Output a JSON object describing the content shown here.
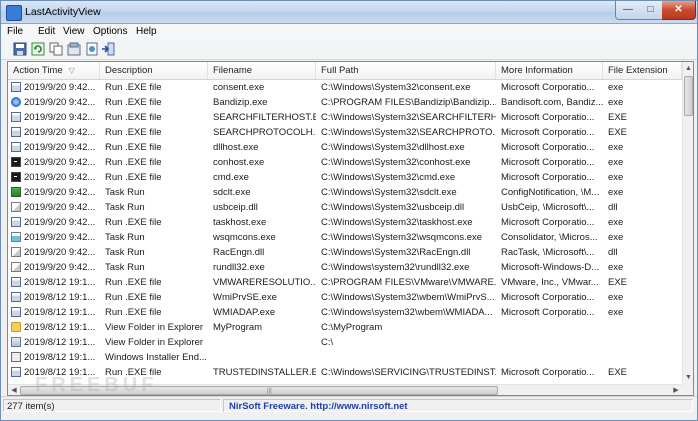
{
  "window": {
    "title": "LastActivityView"
  },
  "menu": [
    "File",
    "Edit",
    "View",
    "Options",
    "Help"
  ],
  "toolbar_icons": [
    "save-icon",
    "refresh-icon",
    "copy-icon",
    "properties-icon",
    "html-report-icon",
    "exit-icon"
  ],
  "columns": [
    {
      "label": "Action Time",
      "sort": "▽"
    },
    {
      "label": "Description"
    },
    {
      "label": "Filename"
    },
    {
      "label": "Full Path"
    },
    {
      "label": "More Information"
    },
    {
      "label": "File Extension"
    }
  ],
  "rows": [
    {
      "icon": "exe-icon",
      "time": "2019/9/20 9:42...",
      "description": "Run .EXE file",
      "filename": "consent.exe",
      "path": "C:\\Windows\\System32\\consent.exe",
      "info": "Microsoft Corporatio...",
      "ext": "exe"
    },
    {
      "icon": "bandizip-icon",
      "time": "2019/9/20 9:42...",
      "description": "Run .EXE file",
      "filename": "Bandizip.exe",
      "path": "C:\\PROGRAM FILES\\Bandizip\\Bandizip....",
      "info": "Bandisoft.com, Bandiz...",
      "ext": "exe"
    },
    {
      "icon": "exe-icon",
      "time": "2019/9/20 9:42...",
      "description": "Run .EXE file",
      "filename": "SEARCHFILTERHOST.E...",
      "path": "C:\\Windows\\System32\\SEARCHFILTERH...",
      "info": "Microsoft Corporatio...",
      "ext": "EXE"
    },
    {
      "icon": "exe-icon",
      "time": "2019/9/20 9:42...",
      "description": "Run .EXE file",
      "filename": "SEARCHPROTOCOLH...",
      "path": "C:\\Windows\\System32\\SEARCHPROTO...",
      "info": "Microsoft Corporatio...",
      "ext": "EXE"
    },
    {
      "icon": "exe-icon",
      "time": "2019/9/20 9:42...",
      "description": "Run .EXE file",
      "filename": "dllhost.exe",
      "path": "C:\\Windows\\System32\\dllhost.exe",
      "info": "Microsoft Corporatio...",
      "ext": "exe"
    },
    {
      "icon": "console-icon",
      "time": "2019/9/20 9:42...",
      "description": "Run .EXE file",
      "filename": "conhost.exe",
      "path": "C:\\Windows\\System32\\conhost.exe",
      "info": "Microsoft Corporatio...",
      "ext": "exe"
    },
    {
      "icon": "cmd-icon",
      "time": "2019/9/20 9:42...",
      "description": "Run .EXE file",
      "filename": "cmd.exe",
      "path": "C:\\Windows\\System32\\cmd.exe",
      "info": "Microsoft Corporatio...",
      "ext": "exe"
    },
    {
      "icon": "monitor-icon",
      "time": "2019/9/20 9:42...",
      "description": "Task Run",
      "filename": "sdclt.exe",
      "path": "C:\\Windows\\System32\\sdclt.exe",
      "info": "ConfigNotification, \\M...",
      "ext": "exe"
    },
    {
      "icon": "dll-icon",
      "time": "2019/9/20 9:42...",
      "description": "Task Run",
      "filename": "usbceip.dll",
      "path": "C:\\Windows\\System32\\usbceip.dll",
      "info": "UsbCeip, \\Microsoft\\...",
      "ext": "dll"
    },
    {
      "icon": "exe-icon",
      "time": "2019/9/20 9:42...",
      "description": "Run .EXE file",
      "filename": "taskhost.exe",
      "path": "C:\\Windows\\System32\\taskhost.exe",
      "info": "Microsoft Corporatio...",
      "ext": "exe"
    },
    {
      "icon": "wsqmcons-icon",
      "time": "2019/9/20 9:42...",
      "description": "Task Run",
      "filename": "wsqmcons.exe",
      "path": "C:\\Windows\\System32\\wsqmcons.exe",
      "info": "Consolidator, \\Micros...",
      "ext": "exe"
    },
    {
      "icon": "dll-icon",
      "time": "2019/9/20 9:42...",
      "description": "Task Run",
      "filename": "RacEngn.dll",
      "path": "C:\\Windows\\System32\\RacEngn.dll",
      "info": "RacTask, \\Microsoft\\...",
      "ext": "dll"
    },
    {
      "icon": "dll-icon",
      "time": "2019/9/20 9:42...",
      "description": "Task Run",
      "filename": "rundll32.exe",
      "path": "C:\\Windows\\system32\\rundll32.exe",
      "info": "Microsoft-Windows-D...",
      "ext": "exe"
    },
    {
      "icon": "exe-icon",
      "time": "2019/8/12 19:1...",
      "description": "Run .EXE file",
      "filename": "VMWARERESOLUTIO...",
      "path": "C:\\PROGRAM FILES\\VMware\\VMWARE...",
      "info": "VMware, Inc., VMwar...",
      "ext": "EXE"
    },
    {
      "icon": "exe-icon",
      "time": "2019/8/12 19:1...",
      "description": "Run .EXE file",
      "filename": "WmiPrvSE.exe",
      "path": "C:\\Windows\\System32\\wbem\\WmiPrvS...",
      "info": "Microsoft Corporatio...",
      "ext": "exe"
    },
    {
      "icon": "exe-icon",
      "time": "2019/8/12 19:1...",
      "description": "Run .EXE file",
      "filename": "WMIADAP.exe",
      "path": "C:\\Windows\\system32\\wbem\\WMIADA...",
      "info": "Microsoft Corporatio...",
      "ext": "exe"
    },
    {
      "icon": "folder-icon",
      "time": "2019/8/12 19:1...",
      "description": "View Folder in Explorer",
      "filename": "MyProgram",
      "path": "C:\\MyProgram",
      "info": "",
      "ext": ""
    },
    {
      "icon": "user-icon",
      "time": "2019/8/12 19:1...",
      "description": "View Folder in Explorer",
      "filename": "",
      "path": "C:\\",
      "info": "",
      "ext": ""
    },
    {
      "icon": "installer-icon",
      "time": "2019/8/12 19:1...",
      "description": "Windows Installer End...",
      "filename": "",
      "path": "",
      "info": "",
      "ext": ""
    },
    {
      "icon": "exe-icon",
      "time": "2019/8/12 19:1...",
      "description": "Run .EXE file",
      "filename": "TRUSTEDINSTALLER.E...",
      "path": "C:\\Windows\\SERVICING\\TRUSTEDINST...",
      "info": "Microsoft Corporatio...",
      "ext": "EXE"
    }
  ],
  "status": {
    "count": "277 item(s)",
    "credit": "NirSoft Freeware.  http://www.nirsoft.net"
  },
  "watermark": "FREEBUF"
}
